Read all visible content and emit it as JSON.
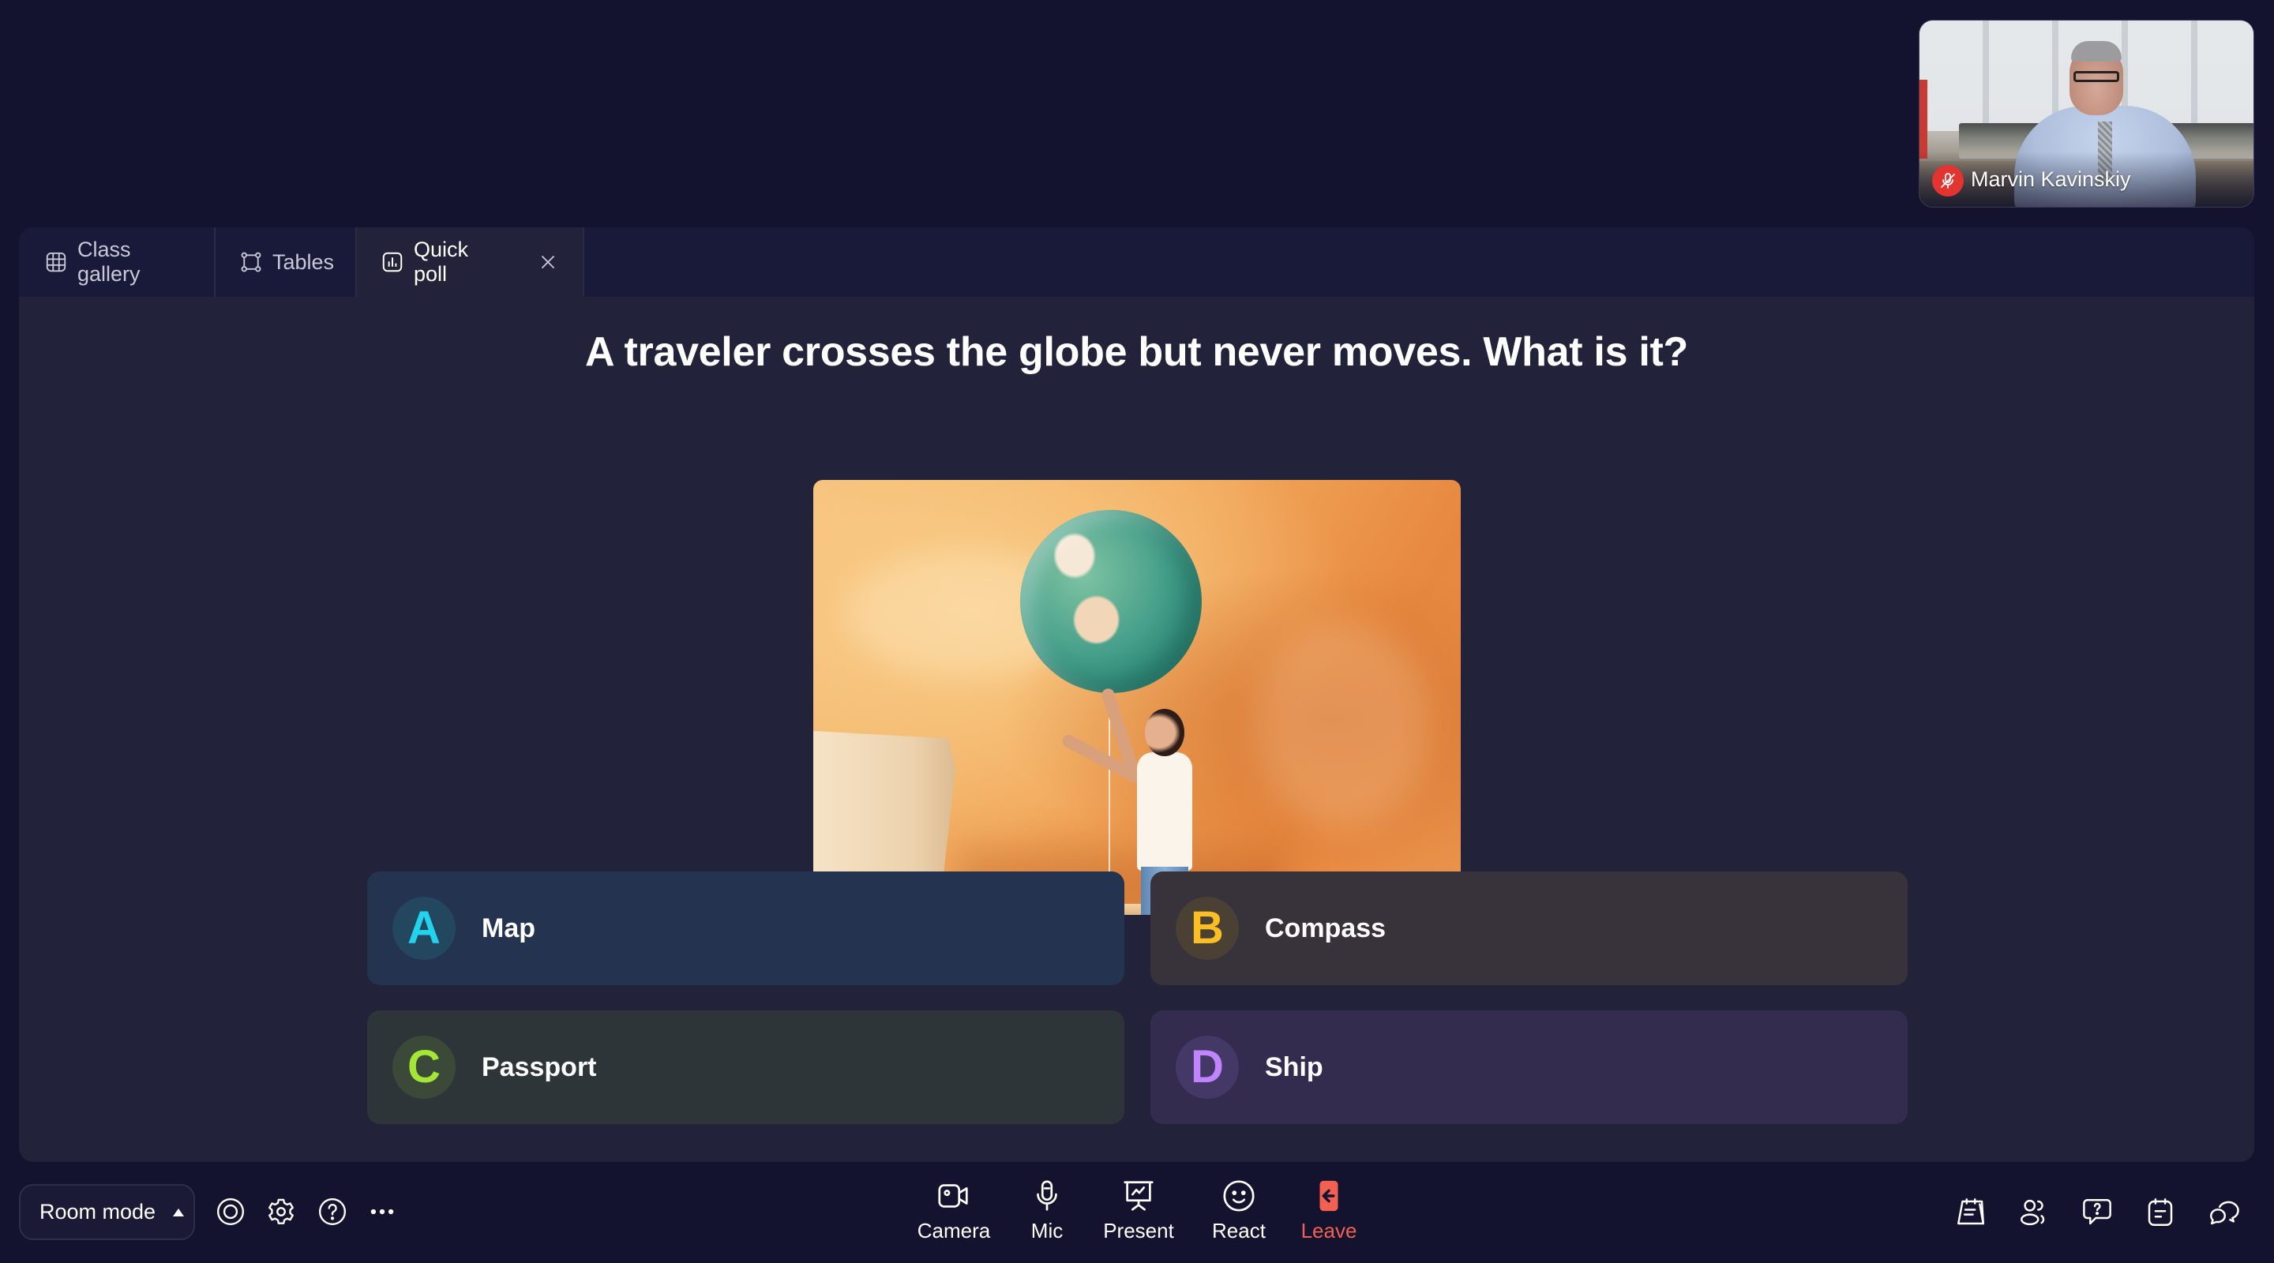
{
  "video_tile": {
    "participant_name": "Marvin Kavinskiy",
    "mic_status": "muted",
    "badge_icon": "mic-off-icon",
    "badge_color": "#e3342f"
  },
  "tabs": [
    {
      "label": "Class gallery",
      "icon": "grid-icon",
      "active": false
    },
    {
      "label": "Tables",
      "icon": "tables-icon",
      "active": false
    },
    {
      "label": "Quick poll",
      "icon": "poll-chart-icon",
      "active": true,
      "closable": true
    }
  ],
  "poll": {
    "question": "A traveler crosses the globe but never moves. What is it?",
    "image_description": "Girl holding a globe balloon against an orange wall",
    "answers": [
      {
        "letter": "A",
        "label": "Map",
        "accent": "#22d3ee",
        "card_color": "#233350"
      },
      {
        "letter": "B",
        "label": "Compass",
        "accent": "#fbbf24",
        "card_color": "#38323b"
      },
      {
        "letter": "C",
        "label": "Passport",
        "accent": "#a3e635",
        "card_color": "#2e3538"
      },
      {
        "letter": "D",
        "label": "Ship",
        "accent": "#c084fc",
        "card_color": "#332c4f"
      }
    ]
  },
  "controls": {
    "room_mode_label": "Room mode",
    "left_icons": [
      "record-icon",
      "settings-gear-icon",
      "help-icon",
      "more-options-icon"
    ],
    "center": [
      {
        "label": "Camera",
        "icon": "camera-icon"
      },
      {
        "label": "Mic",
        "icon": "mic-icon"
      },
      {
        "label": "Present",
        "icon": "present-icon"
      },
      {
        "label": "React",
        "icon": "smiley-icon"
      },
      {
        "label": "Leave",
        "icon": "leave-icon",
        "color": "#f26052"
      }
    ],
    "right_icons": [
      "agenda-icon",
      "participants-icon",
      "questions-icon",
      "notes-icon",
      "chat-icon"
    ]
  },
  "colors": {
    "page_bg": "#131330",
    "panel_bg": "#22223a",
    "tabbar_bg": "#19193a",
    "leave": "#f26052"
  }
}
